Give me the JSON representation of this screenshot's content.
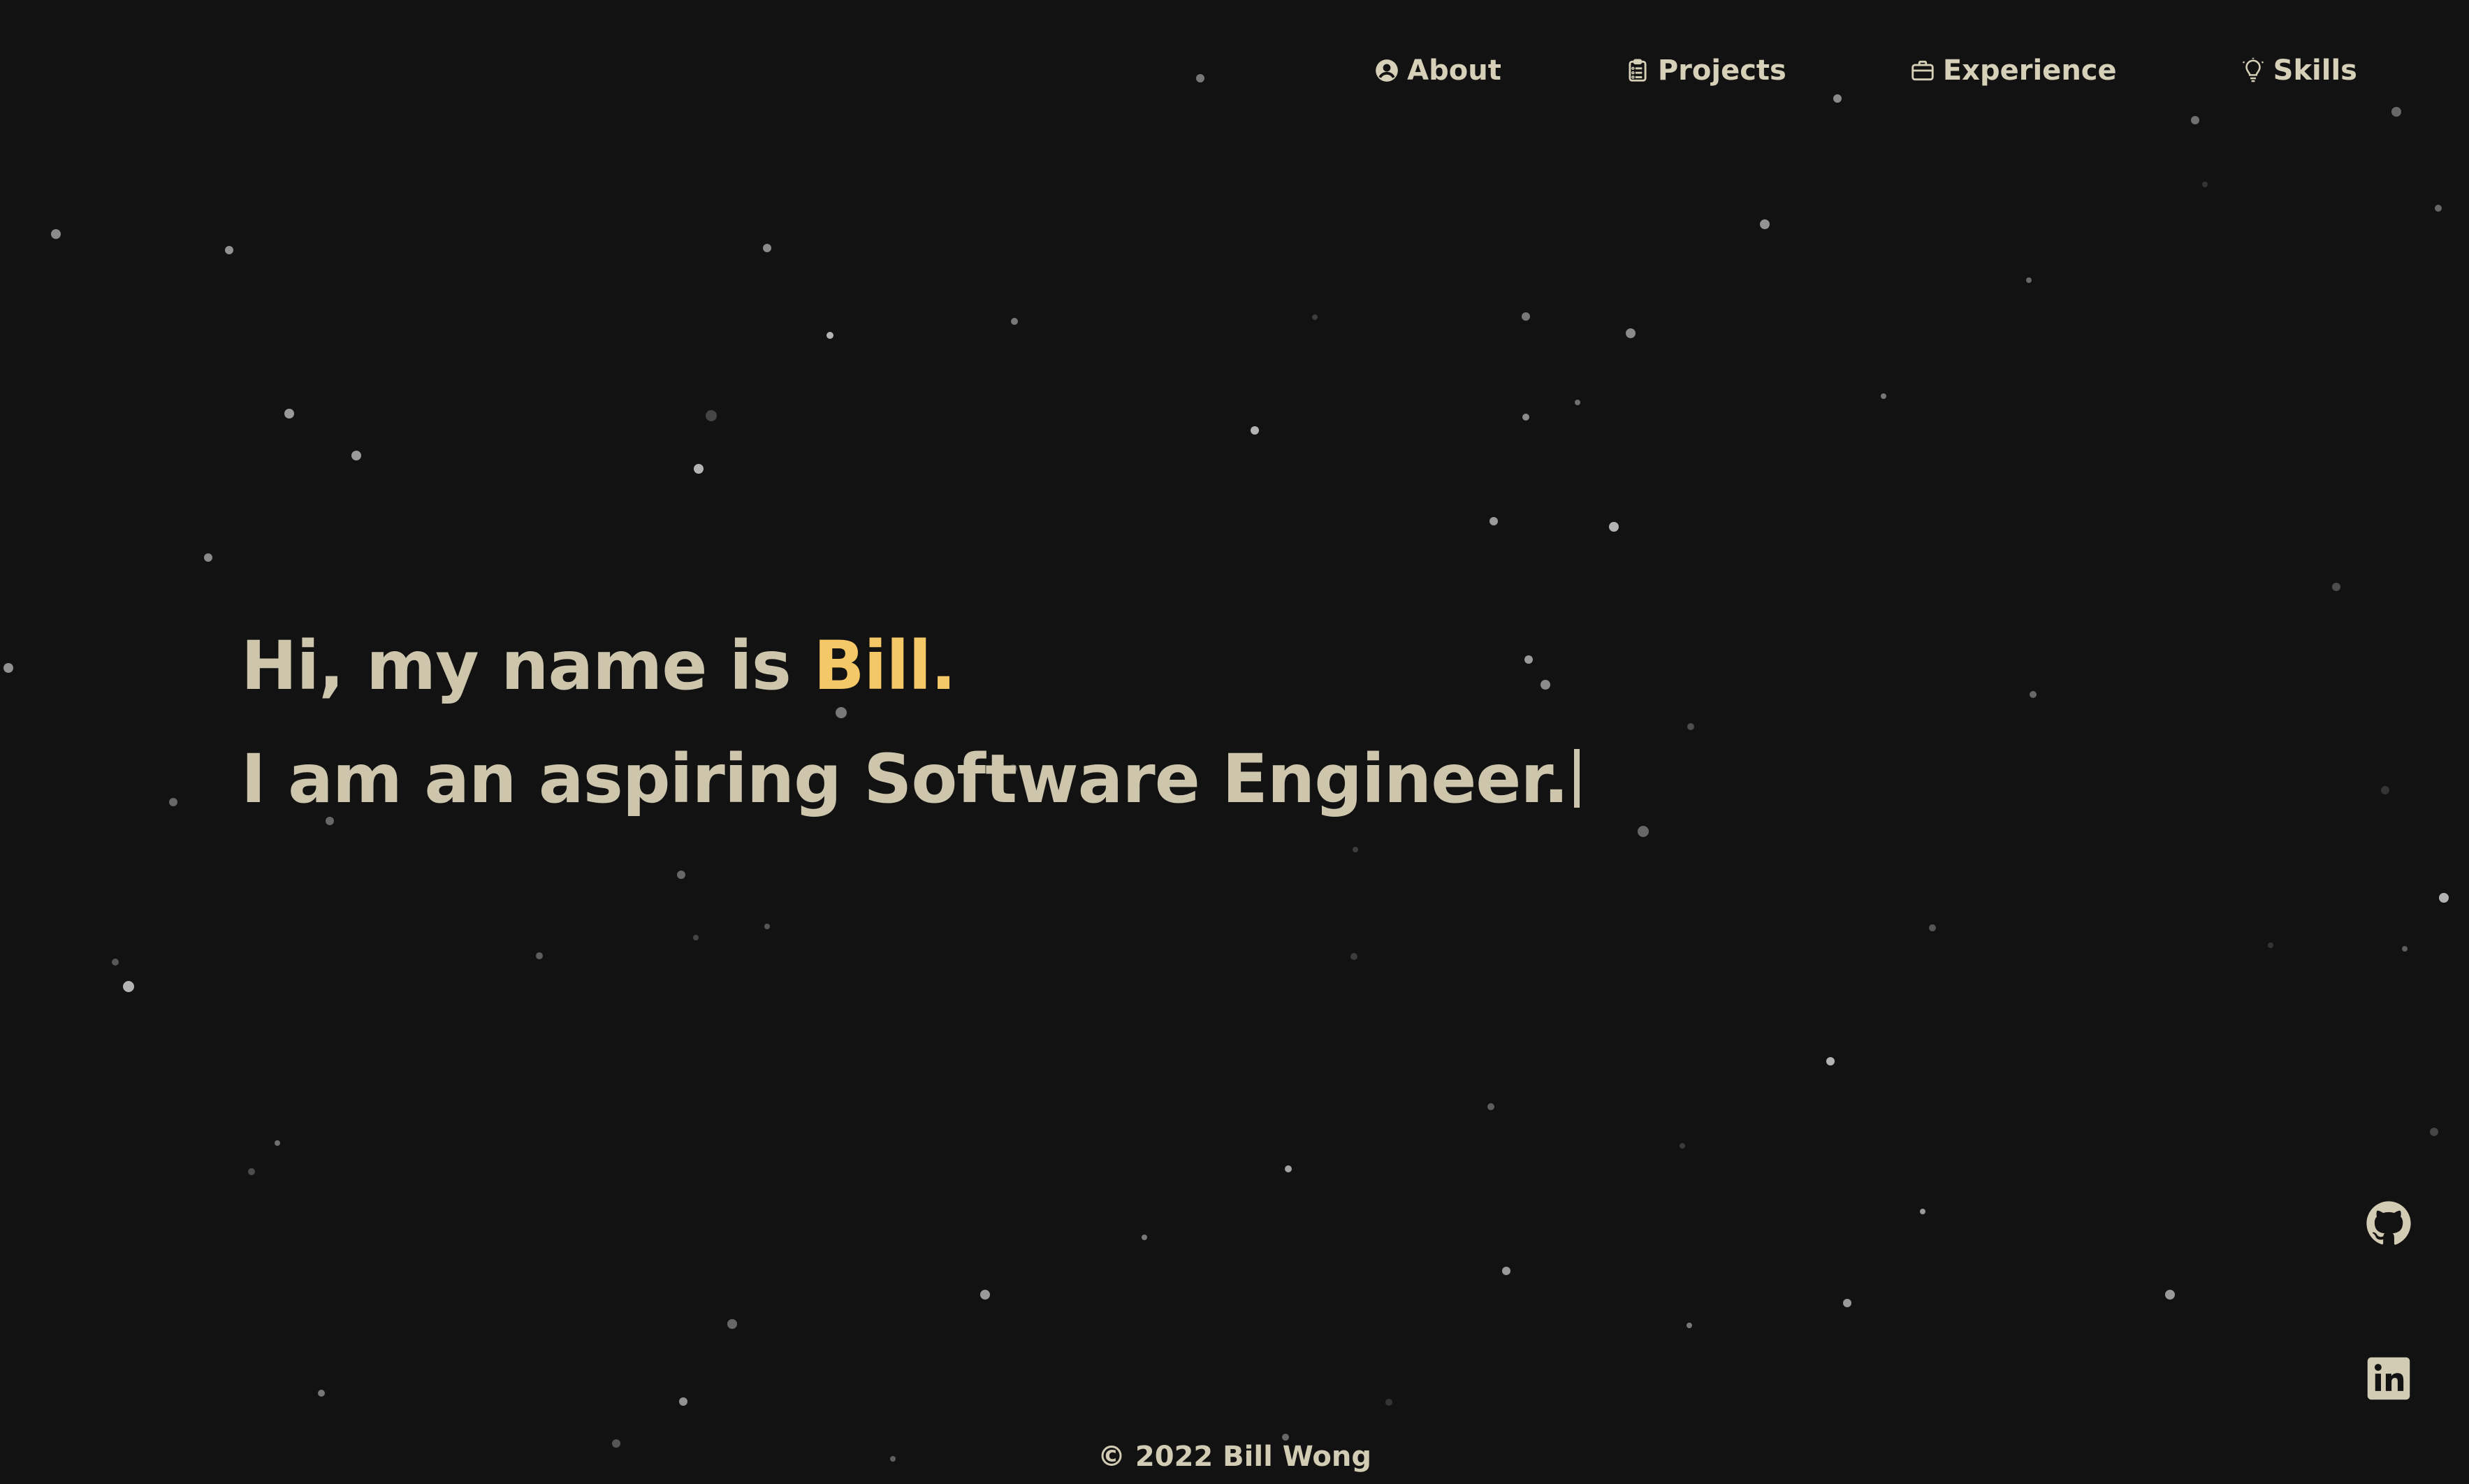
{
  "nav": {
    "items": [
      {
        "label": "About",
        "icon": "user-circle-icon"
      },
      {
        "label": "Projects",
        "icon": "clipboard-list-icon"
      },
      {
        "label": "Experience",
        "icon": "briefcase-icon"
      },
      {
        "label": "Skills",
        "icon": "lightbulb-icon"
      }
    ]
  },
  "hero": {
    "greeting_prefix": "Hi, my name is ",
    "name": "Bill",
    "name_suffix": ".",
    "tagline": "I am an aspiring Software Engineer."
  },
  "social": {
    "github_icon": "github-icon",
    "linkedin_icon": "linkedin-icon"
  },
  "footer": {
    "copyright": "© 2022 Bill Wong"
  },
  "colors": {
    "background": "#121212",
    "text": "#cdc6ad",
    "accent": "#f5c867"
  }
}
